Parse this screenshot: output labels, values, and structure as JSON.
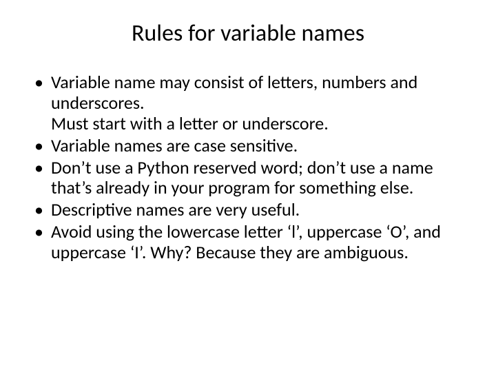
{
  "slide": {
    "title": "Rules for variable names",
    "bullets": [
      {
        "line1": "Variable name may consist of letters, numbers and underscores.",
        "line2": "Must start with a letter or underscore."
      },
      {
        "line1": "Variable names are case sensitive."
      },
      {
        "line1": "Don’t use a Python reserved word; don’t use a name that’s already in your program for something else."
      },
      {
        "line1": "Descriptive names are very useful."
      },
      {
        "line1": "Avoid using the lowercase letter ‘l’, uppercase ‘O’, and uppercase ‘I’. Why? Because they are ambiguous."
      }
    ]
  }
}
